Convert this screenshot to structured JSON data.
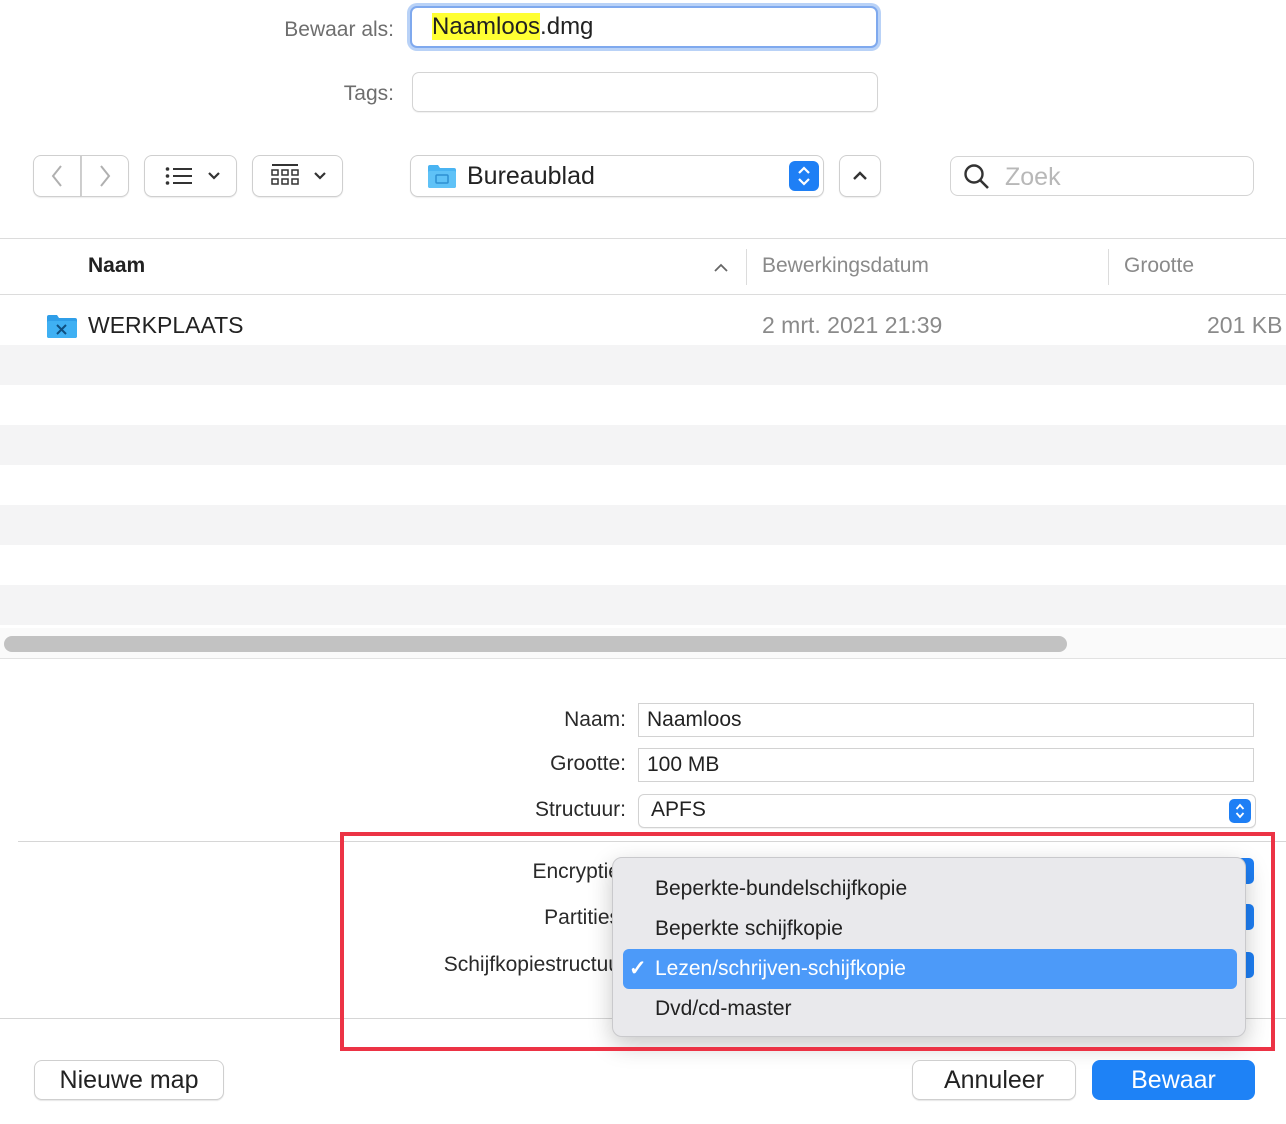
{
  "save": {
    "label": "Bewaar als:",
    "filename_highlight": "Naamloos",
    "filename_ext": ".dmg",
    "tags_label": "Tags:",
    "tags_value": ""
  },
  "toolbar": {
    "back_icon": "chevron-left-icon",
    "forward_icon": "chevron-right-icon",
    "list_view_icon": "list-icon",
    "group_icon": "grid-icon",
    "location": "Bureaublad",
    "search_placeholder": "Zoek"
  },
  "file_list": {
    "columns": [
      "Naam",
      "Bewerkingsdatum",
      "Grootte"
    ],
    "sort_indicator": "^",
    "rows": [
      {
        "name": "WERKPLAATS",
        "date": "2 mrt. 2021 21:39",
        "size": "201 KB"
      }
    ]
  },
  "form": {
    "name_label": "Naam:",
    "name_value": "Naamloos",
    "size_label": "Grootte:",
    "size_value": "100 MB",
    "structure_label": "Structuur:",
    "structure_value": "APFS",
    "encryption_label": "Encryptie",
    "partitions_label": "Partities",
    "image_structure_label": "Schijfkopiestructuu"
  },
  "format_menu": {
    "items": [
      "Beperkte-bundelschijfkopie",
      "Beperkte schijfkopie",
      "Lezen/schrijven-schijfkopie",
      "Dvd/cd-master"
    ],
    "selected_index": 2,
    "checkmark": "✓"
  },
  "buttons": {
    "new_folder": "Nieuwe map",
    "cancel": "Annuleer",
    "save": "Bewaar"
  },
  "colors": {
    "accent": "#1e82f6",
    "highlight": "#ffff33",
    "annotation": "#ec3345"
  }
}
